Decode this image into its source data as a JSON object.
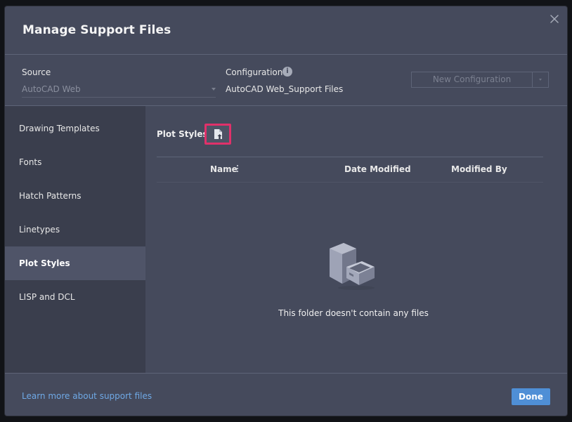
{
  "dialog": {
    "title": "Manage Support Files"
  },
  "config": {
    "source_label": "Source",
    "source_value": "AutoCAD Web",
    "configuration_label": "Configuration",
    "configuration_value": "AutoCAD Web_Support Files",
    "new_configuration_label": "New Configuration",
    "info_glyph": "i"
  },
  "sidebar": {
    "items": [
      {
        "label": "Drawing Templates",
        "active": false
      },
      {
        "label": "Fonts",
        "active": false
      },
      {
        "label": "Hatch Patterns",
        "active": false
      },
      {
        "label": "Linetypes",
        "active": false
      },
      {
        "label": "Plot Styles",
        "active": true
      },
      {
        "label": "LISP and DCL",
        "active": false
      }
    ]
  },
  "content": {
    "section_title": "Plot Styles",
    "columns": [
      "Name",
      "Date Modified",
      "Modified By"
    ],
    "empty_message": "This folder doesn't contain any files"
  },
  "footer": {
    "learn_more": "Learn more about support files",
    "done_label": "Done"
  },
  "icons": {
    "close": "close-icon",
    "info": "info-icon",
    "upload": "upload-file-icon",
    "empty": "file-cabinet-icon",
    "column_menu": "column-menu-icon"
  },
  "colors": {
    "dialog_bg": "#454a5c",
    "sidebar_bg": "#3a3e4d",
    "active_item_bg": "#4f5468",
    "highlight_border": "#e0316a",
    "primary_button": "#4f8fd6",
    "link": "#6fa9e6"
  }
}
